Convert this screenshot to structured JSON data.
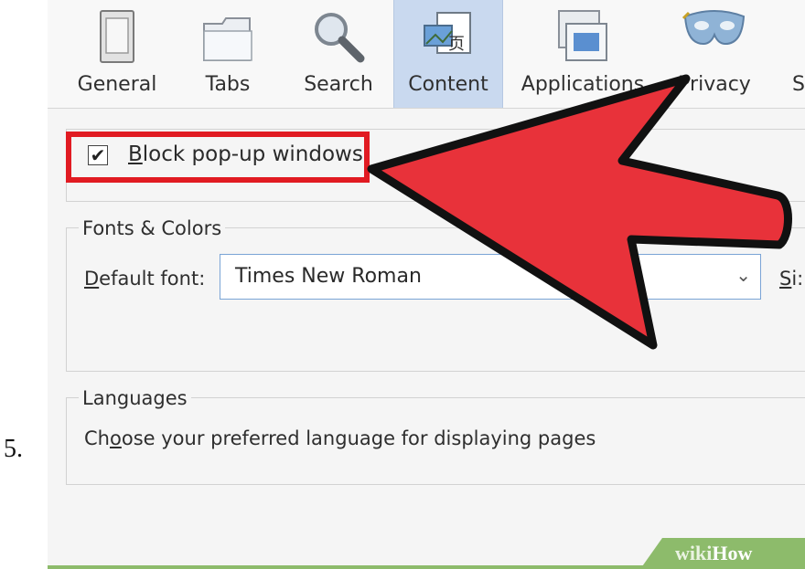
{
  "step_number": "5.",
  "toolbar": {
    "tabs": [
      {
        "label": "General",
        "icon": "general-icon"
      },
      {
        "label": "Tabs",
        "icon": "tabs-icon"
      },
      {
        "label": "Search",
        "icon": "search-icon"
      },
      {
        "label": "Content",
        "icon": "content-icon",
        "selected": true
      },
      {
        "label": "Applications",
        "icon": "applications-icon"
      },
      {
        "label": "Privacy",
        "icon": "privacy-mask-icon"
      },
      {
        "label": "S",
        "icon": "security-icon"
      }
    ]
  },
  "popups": {
    "checkbox_checked": true,
    "label_accel": "B",
    "label_rest": "lock pop-up windows"
  },
  "fonts_colors": {
    "legend": "Fonts & Colors",
    "default_font_label_accel": "D",
    "default_font_label_rest": "efault font:",
    "default_font_value": "Times New Roman",
    "size_label_accel": "S",
    "size_label_rest": "i:"
  },
  "languages": {
    "legend": "Languages",
    "choose_text_pre": "Ch",
    "choose_text_accel": "o",
    "choose_text_post": "ose your preferred language for displaying pages"
  },
  "watermark": {
    "prefix": "wiki",
    "brand": "How"
  },
  "colors": {
    "highlight_red": "#e11b22",
    "arrow_red": "#e8323a",
    "selected_tab": "#c9d9ef",
    "wikihow_green": "#8dbb6b"
  }
}
